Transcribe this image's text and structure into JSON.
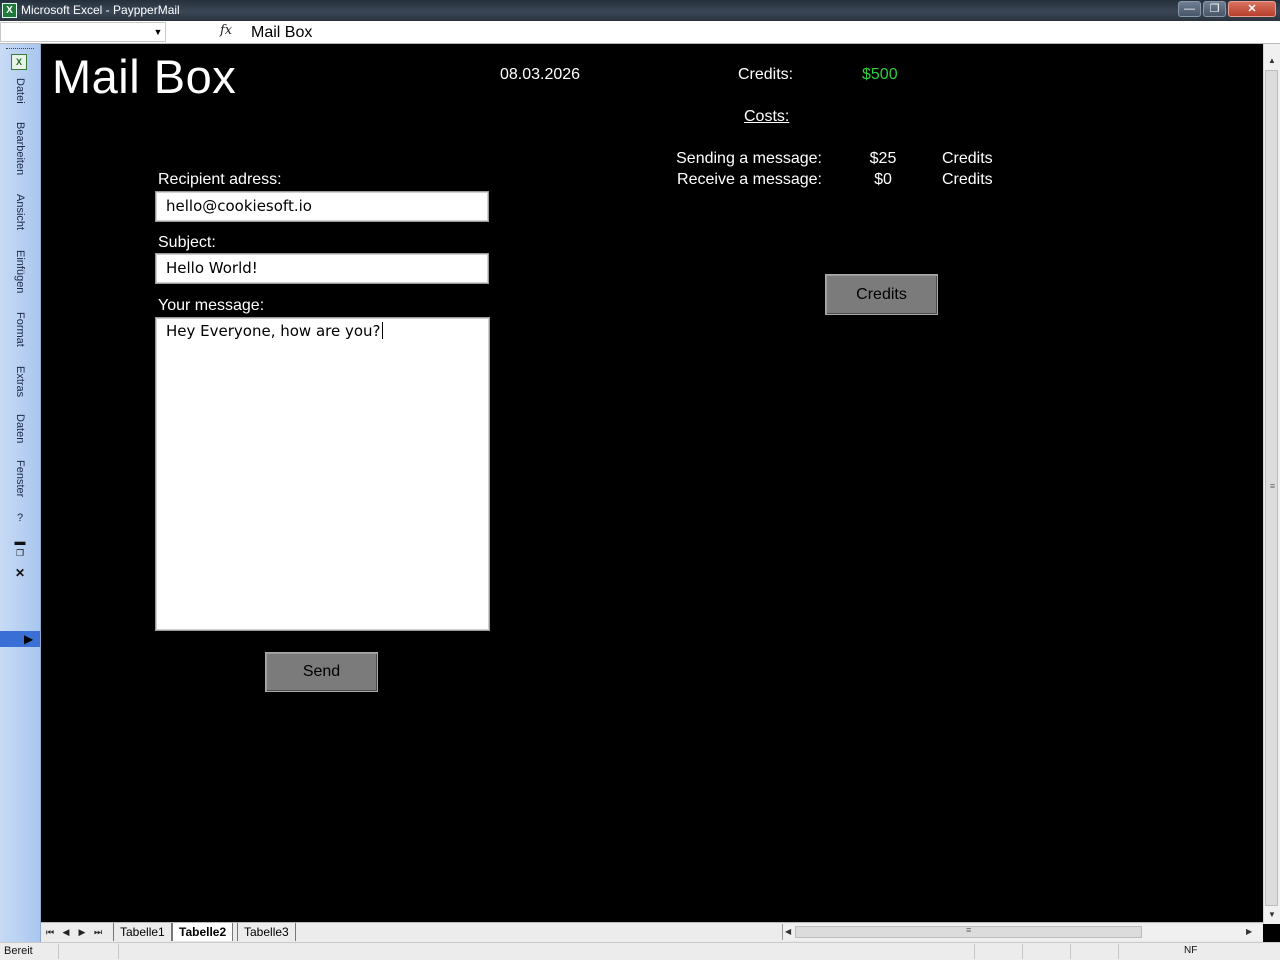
{
  "window": {
    "title": "Microsoft Excel - PaypperMail",
    "app_icon": "excel-icon",
    "app_icon_glyph": "X",
    "controls": {
      "minimize": "—",
      "maximize": "❐",
      "close": "✕"
    }
  },
  "formula_bar": {
    "name_box": "",
    "name_box_arrow": "▼",
    "fx": "fx",
    "content": "Mail Box"
  },
  "menu": {
    "items": [
      "Datei",
      "Bearbeiten",
      "Ansicht",
      "Einfügen",
      "Format",
      "Extras",
      "Daten",
      "Fenster"
    ],
    "help": "?",
    "min": "▬",
    "restore": "❐",
    "close": "✕",
    "expand": "▶"
  },
  "sheet": {
    "title": "Mail Box",
    "date": "08.03.2026",
    "credits": {
      "label": "Credits:",
      "value": "$500",
      "value_color": "#2ecf3a"
    },
    "costs": {
      "heading": "Costs:",
      "rows": [
        {
          "label": "Sending a message:",
          "amount": "$25",
          "unit": "Credits"
        },
        {
          "label": "Receive a message:",
          "amount": "$0",
          "unit": "Credits"
        }
      ]
    },
    "form": {
      "recipient_label": "Recipient adress:",
      "recipient_value": "hello@cookiesoft.io",
      "subject_label": "Subject:",
      "subject_value": "Hello World!",
      "message_label": "Your message:",
      "message_value": "Hey Everyone, how are you?"
    },
    "buttons": {
      "send": "Send",
      "credits": "Credits"
    }
  },
  "tabs": {
    "nav": [
      "⏮",
      "◀",
      "▶",
      "⏭"
    ],
    "sheets": [
      "Tabelle1",
      "Tabelle2",
      "Tabelle3"
    ],
    "active": "Tabelle2"
  },
  "scrollbars": {
    "up": "▲",
    "down": "▼",
    "left": "◀",
    "right": "▶",
    "grip": "≡"
  },
  "status": {
    "text": "Bereit",
    "nf": "NF"
  }
}
